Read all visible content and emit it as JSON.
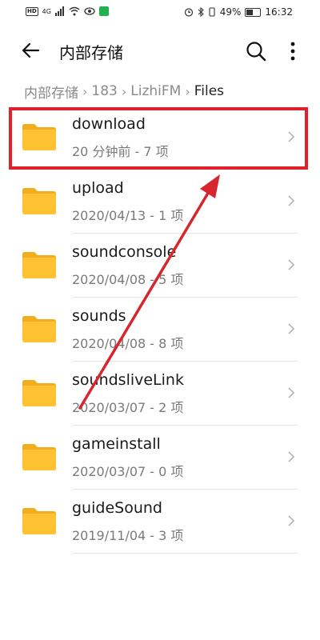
{
  "status_bar": {
    "battery_percent": "49%",
    "time": "16:32",
    "network_hd": "HD",
    "signal_label": "4G"
  },
  "toolbar": {
    "title": "内部存储"
  },
  "breadcrumb": {
    "items": [
      "内部存储",
      "183",
      "LizhiFM",
      "Files"
    ]
  },
  "files": [
    {
      "name": "download",
      "meta": "20 分钟前 - 7 项"
    },
    {
      "name": "upload",
      "meta": "2020/04/13 - 1 项"
    },
    {
      "name": "soundconsole",
      "meta": "2020/04/08 - 5 项"
    },
    {
      "name": "sounds",
      "meta": "2020/04/08 - 8 项"
    },
    {
      "name": "soundsliveLink",
      "meta": "2020/03/07 - 2 项"
    },
    {
      "name": "gameinstall",
      "meta": "2020/03/07 - 0 项"
    },
    {
      "name": "guideSound",
      "meta": "2019/11/04 - 3 项"
    }
  ],
  "colors": {
    "folder": "#ffc233",
    "folder_tab": "#f3ad1e",
    "highlight": "#e0202a",
    "arrow": "#d7262e"
  },
  "icons": {
    "back": "arrow-left-icon",
    "search": "search-icon",
    "more": "more-vertical-icon",
    "folder": "folder-icon",
    "chevron": "chevron-right-icon"
  }
}
